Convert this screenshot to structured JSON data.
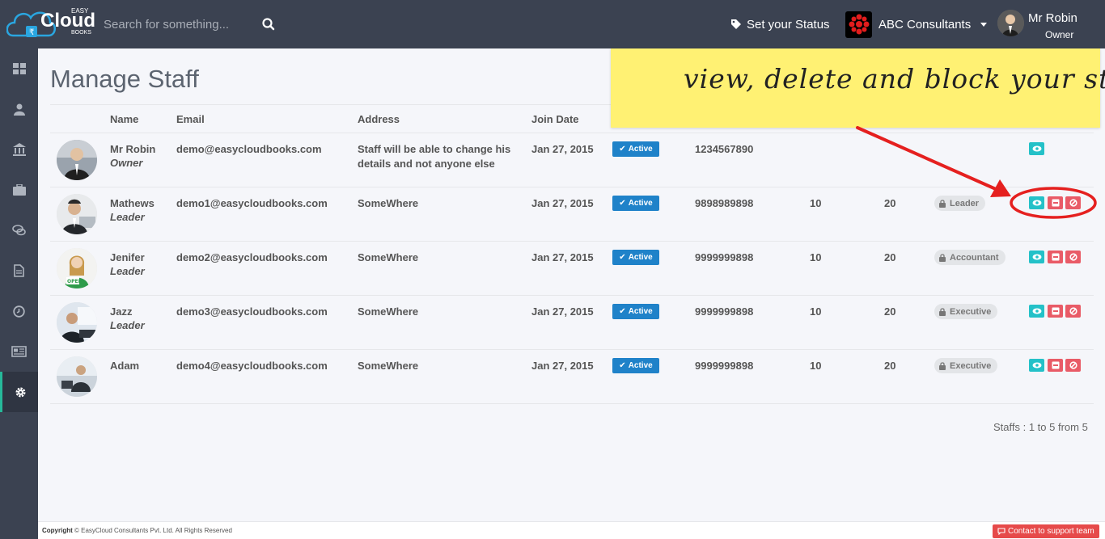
{
  "header": {
    "brand_top": "EASY",
    "brand": "Cloud",
    "brand_sub": "BOOKS",
    "search_placeholder": "Search for something...",
    "status_label": "Set your Status",
    "company_name": "ABC Consultants",
    "user_name": "Mr Robin",
    "user_role": "Owner"
  },
  "sidebar": {
    "items": [
      {
        "icon": "dashboard-icon"
      },
      {
        "icon": "user-icon"
      },
      {
        "icon": "bank-icon"
      },
      {
        "icon": "briefcase-icon"
      },
      {
        "icon": "chat-icon"
      },
      {
        "icon": "document-icon"
      },
      {
        "icon": "clock-icon"
      },
      {
        "icon": "newspaper-icon"
      },
      {
        "icon": "gear-icon",
        "active": true
      }
    ]
  },
  "page": {
    "title": "Manage Staff"
  },
  "table": {
    "headers": [
      "Name",
      "Email",
      "Address",
      "Join Date"
    ],
    "status_label": "Active",
    "rows": [
      {
        "name": "Mr Robin",
        "role": "Owner",
        "email": "demo@easycloudbooks.com",
        "address_line1": "Staff will be able to change his",
        "address_line2": "details and not anyone else",
        "join_date": "Jan 27, 2015",
        "phone": "1234567890",
        "col_a": "",
        "col_b": "",
        "designation": ""
      },
      {
        "name": "Mathews",
        "role": "Leader",
        "email": "demo1@easycloudbooks.com",
        "address_line1": "SomeWhere",
        "address_line2": "",
        "join_date": "Jan 27, 2015",
        "phone": "9898989898",
        "col_a": "10",
        "col_b": "20",
        "designation": "Leader"
      },
      {
        "name": "Jenifer",
        "role": "Leader",
        "email": "demo2@easycloudbooks.com",
        "address_line1": "SomeWhere",
        "address_line2": "",
        "join_date": "Jan 27, 2015",
        "phone": "9999999898",
        "col_a": "10",
        "col_b": "20",
        "designation": "Accountant"
      },
      {
        "name": "Jazz",
        "role": "Leader",
        "email": "demo3@easycloudbooks.com",
        "address_line1": "SomeWhere",
        "address_line2": "",
        "join_date": "Jan 27, 2015",
        "phone": "9999999898",
        "col_a": "10",
        "col_b": "20",
        "designation": "Executive"
      },
      {
        "name": "Adam",
        "role": "",
        "email": "demo4@easycloudbooks.com",
        "address_line1": "SomeWhere",
        "address_line2": "",
        "join_date": "Jan 27, 2015",
        "phone": "9999999898",
        "col_a": "10",
        "col_b": "20",
        "designation": "Executive"
      }
    ]
  },
  "pager": {
    "text": "Staffs : 1 to 5 from 5"
  },
  "annotation": {
    "text": "view, delete and block your staff"
  },
  "footer": {
    "copyright_label": "Copyright",
    "copyright_text": "© EasyCloud Consultants Pvt. Ltd. All Rights Reserved",
    "support_label": "Contact to support team"
  },
  "colors": {
    "topbar": "#3b4251",
    "active_badge": "#1f82c9",
    "view_button": "#24c1c8",
    "delete_button": "#e95b67",
    "note": "#fff173",
    "arrow": "#e5201f"
  }
}
